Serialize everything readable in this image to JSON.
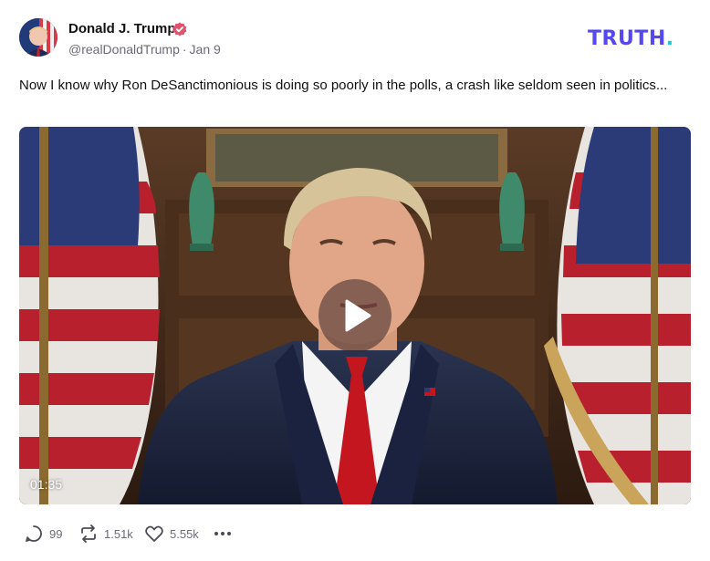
{
  "post": {
    "author_name": "Donald J. Trump",
    "handle": "@realDonaldTrump",
    "separator": "·",
    "date": "Jan 9",
    "text": "Now I know why Ron DeSanctimonious is doing so poorly in the polls, a crash like seldom seen in politics...",
    "verified_icon": "verified-badge-icon"
  },
  "brand": {
    "logo_text": "TRUTH",
    "logo_period": ".",
    "colors": {
      "logo": "#5448ee",
      "period": "#23c8d6",
      "verified": "#e3536e"
    }
  },
  "video": {
    "duration": "01:35",
    "play_icon": "play-icon"
  },
  "actions": {
    "replies": "99",
    "retruths": "1.51k",
    "likes": "5.55k",
    "icons": [
      "reply-icon",
      "retruth-icon",
      "like-icon",
      "more-icon"
    ]
  }
}
